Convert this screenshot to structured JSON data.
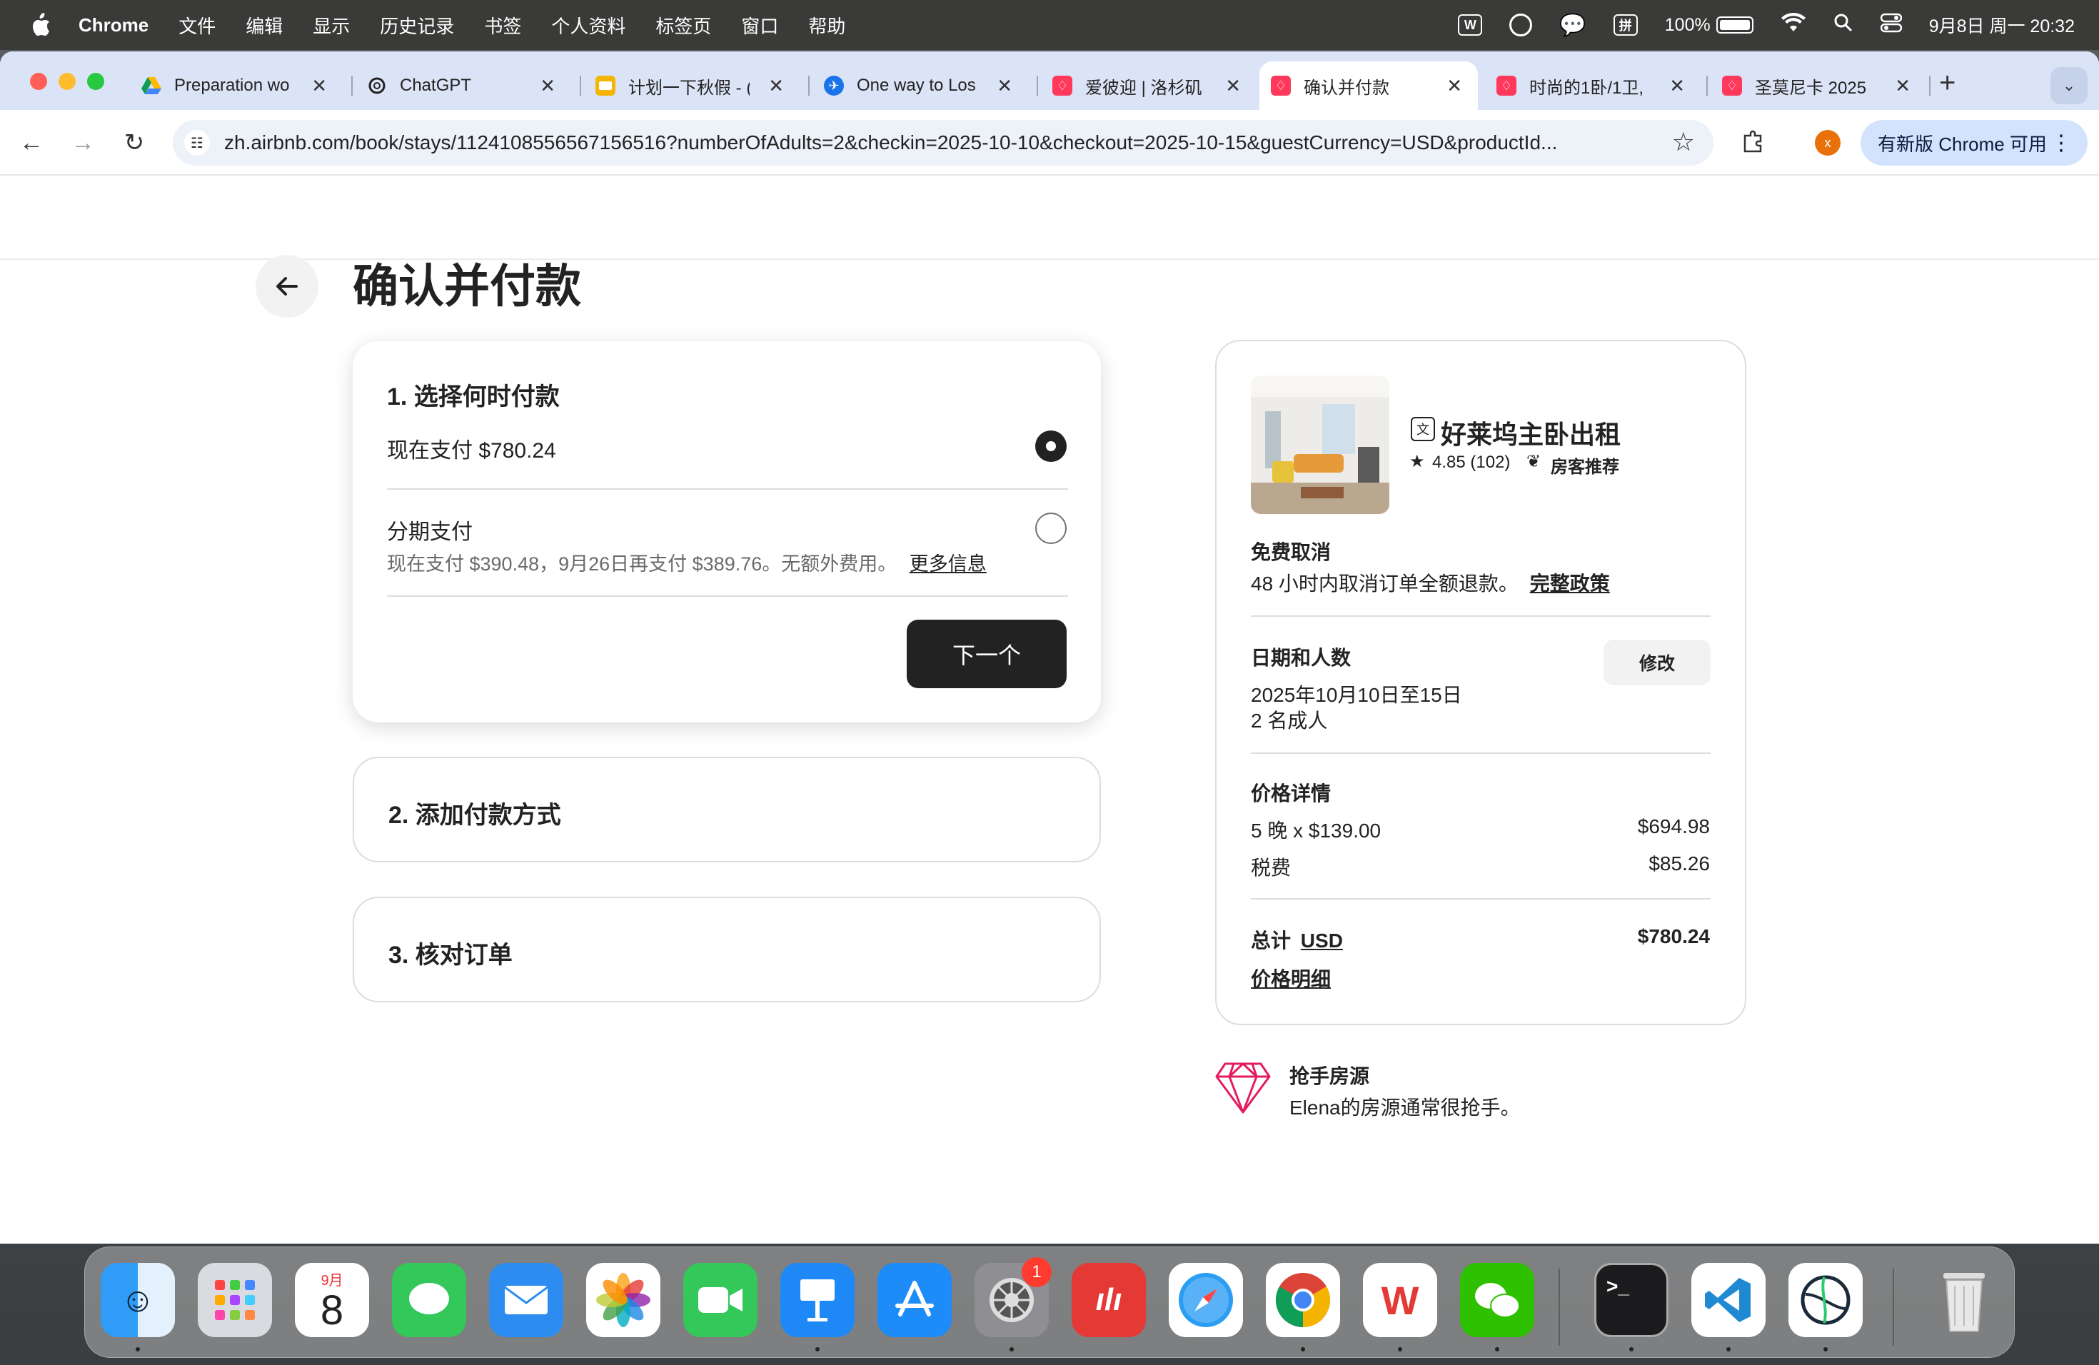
{
  "menubar": {
    "app": "Chrome",
    "items": [
      "文件",
      "编辑",
      "显示",
      "历史记录",
      "书签",
      "个人资料",
      "标签页",
      "窗口",
      "帮助"
    ],
    "battery": "100%",
    "datetime": "9月8日 周一  20:32",
    "input_method": "拼"
  },
  "tabs": [
    {
      "title": "Preparation wo",
      "icon": "google-drive-icon",
      "color": "#f4b400"
    },
    {
      "title": "ChatGPT",
      "icon": "chatgpt-icon",
      "color": "#222222"
    },
    {
      "title": "计划一下秋假 - (",
      "icon": "slides-icon",
      "color": "#f4b400"
    },
    {
      "title": "One way to Los",
      "icon": "flight-icon",
      "color": "#1a73e8"
    },
    {
      "title": "爱彼迎 | 洛杉矶",
      "icon": "airbnb-icon",
      "color": "#ff385c"
    },
    {
      "title": "确认并付款",
      "icon": "airbnb-icon",
      "color": "#ff385c"
    },
    {
      "title": "时尚的1卧/1卫,",
      "icon": "airbnb-icon",
      "color": "#ff385c"
    },
    {
      "title": "圣莫尼卡 2025",
      "icon": "airbnb-icon",
      "color": "#ff385c"
    }
  ],
  "active_tab": 5,
  "address_bar": {
    "url": "zh.airbnb.com/book/stays/1124108556567156516?numberOfAdults=2&checkin=2025-10-10&checkout=2025-10-15&guestCurrency=USD&productId..."
  },
  "profile_initial": "x",
  "update_button": "有新版 Chrome 可用",
  "page": {
    "title": "确认并付款",
    "step1": {
      "heading": "1. 选择何时付款",
      "option_now": "现在支付 $780.24",
      "option_installment": "分期支付",
      "installment_detail": "现在支付 $390.48，9月26日再支付 $389.76。无额外费用。",
      "more_info": "更多信息",
      "next_button": "下一个",
      "selected": "now"
    },
    "step2": {
      "heading": "2. 添加付款方式"
    },
    "step3": {
      "heading": "3. 核对订单"
    },
    "summary": {
      "listing_title": "好莱坞主卧出租",
      "rating": "4.85 (102)",
      "guest_favorite": "房客推荐",
      "free_cancel_title": "免费取消",
      "free_cancel_text": "48 小时内取消订单全额退款。",
      "full_policy": "完整政策",
      "dates_title": "日期和人数",
      "dates": "2025年10月10日至15日",
      "guests": "2 名成人",
      "edit_button": "修改",
      "price_title": "价格详情",
      "nights_label": "5 晚 x $139.00",
      "nights_amount": "$694.98",
      "tax_label": "税费",
      "tax_amount": "$85.26",
      "total_label": "总计",
      "currency": "USD",
      "total_amount": "$780.24",
      "price_breakdown": "价格明细"
    },
    "rare_find": {
      "title": "抢手房源",
      "text": "Elena的房源通常很抢手。"
    }
  },
  "dock": {
    "calendar_month": "9月",
    "calendar_day": "8",
    "settings_badge": "1",
    "apps": [
      "finder-icon",
      "launchpad-icon",
      "calendar-icon",
      "messages-icon",
      "mail-icon",
      "photos-icon",
      "facetime-icon",
      "keynote-icon",
      "app-store-icon",
      "system-settings-icon",
      "oppo-app-icon",
      "safari-icon",
      "chrome-icon",
      "wps-icon",
      "wechat-icon",
      "terminal-icon",
      "vscode-icon",
      "webstorm-icon",
      "trash-icon"
    ]
  }
}
